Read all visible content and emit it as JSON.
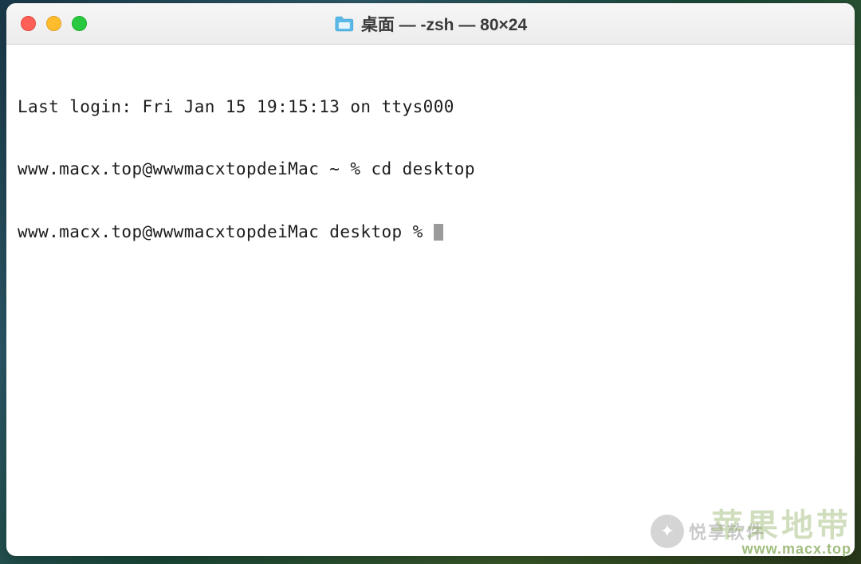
{
  "window": {
    "title": "桌面 — -zsh — 80×24",
    "traffic_lights": {
      "close_color": "#ff5f57",
      "minimize_color": "#ffbd2e",
      "maximize_color": "#28c940"
    }
  },
  "terminal": {
    "lines": [
      "Last login: Fri Jan 15 19:15:13 on ttys000",
      "www.macx.top@wwwmacxtopdeiMac ~ % cd desktop",
      "www.macx.top@wwwmacxtopdeiMac desktop % "
    ]
  },
  "watermark": {
    "logo_text": "苹果地带",
    "url": "www.macx.top",
    "chat_label": "悦享软件"
  }
}
